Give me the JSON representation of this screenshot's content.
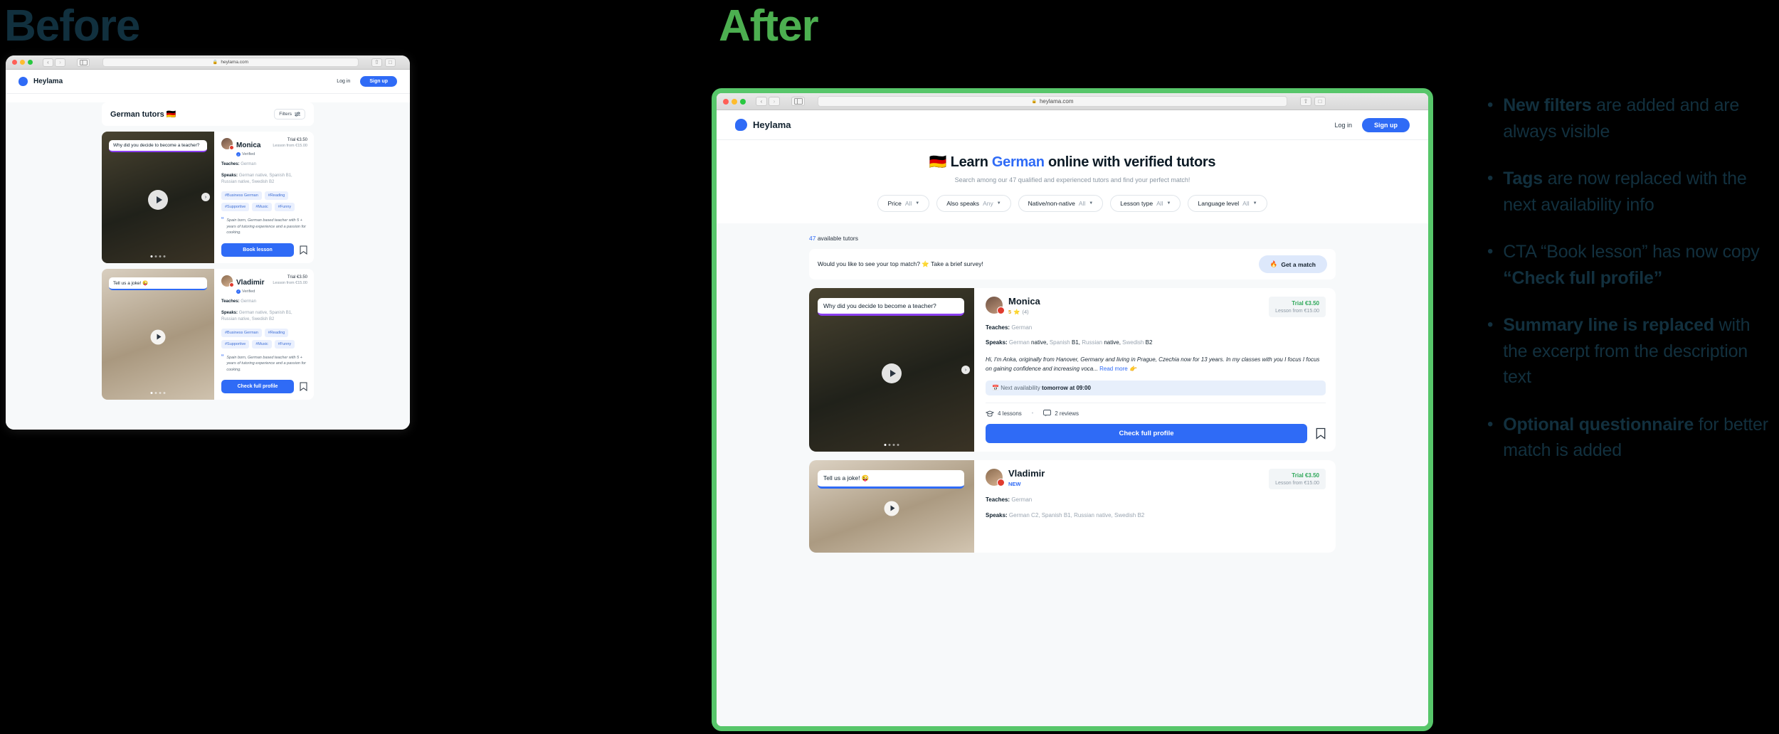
{
  "section_titles": {
    "before": "Before",
    "after": "After"
  },
  "colors": {
    "accent_blue": "#2f6bf6",
    "after_green": "#4caf50",
    "heading_navy": "#12303e",
    "chip_purple": "#8b3ff0"
  },
  "browser": {
    "url": "heylama.com",
    "lock_icon": "lock-icon",
    "back_icon": "‹",
    "forward_icon": "›",
    "sidebar_icon": "sidebar-icon",
    "share_icon": "share-icon",
    "tabs_icon": "new-tab-icon",
    "plus_icon": "+"
  },
  "site_header": {
    "brand": "Heylama",
    "login": "Log in",
    "signup": "Sign up"
  },
  "before": {
    "page_title": "German tutors 🇩🇪",
    "filters_label": "Filters",
    "filters_icon": "sliders-icon",
    "cards": [
      {
        "video_question": "Why did you decide to become a teacher?",
        "name": "Monica",
        "verified": "Verified",
        "trial": "Trial €3.50",
        "lesson_from": "Lesson from €15.00",
        "teaches_label": "Teaches:",
        "teaches_value": "German",
        "speaks_label": "Speaks:",
        "speaks_value": "German native, Spanish B1, Russian native, Swedish B2",
        "tags": [
          "#Business German",
          "#Reading",
          "#Supportive",
          "#Music",
          "#Funny"
        ],
        "quote": "Spain born, German based teacher with 5 + years of tutoring experience and a passion for cooking.",
        "cta": "Book lesson",
        "bookmark_icon": "bookmark-icon"
      },
      {
        "video_question": "Tell us a joke! 😜",
        "name": "Vladimir",
        "verified": "Verified",
        "trial": "Trial €3.50",
        "lesson_from": "Lesson from €15.00",
        "teaches_label": "Teaches:",
        "teaches_value": "German",
        "speaks_label": "Speaks:",
        "speaks_value": "German native, Spanish B1, Russian native, Swedish B2",
        "tags": [
          "#Business German",
          "#Reading",
          "#Supportive",
          "#Music",
          "#Funny"
        ],
        "quote": "Spain born, German based teacher with 5 + years of tutoring experience and a passion for cooking.",
        "cta": "Check full profile",
        "bookmark_icon": "bookmark-icon"
      }
    ]
  },
  "after": {
    "hero": {
      "flag": "🇩🇪",
      "title_pre": "Learn ",
      "title_highlight": "German",
      "title_post": " online with verified tutors",
      "subtitle": "Search among our 47 qualified and experienced tutors and find your perfect match!"
    },
    "filters": [
      {
        "label": "Price",
        "value": "All"
      },
      {
        "label": "Also speaks",
        "value": "Any"
      },
      {
        "label": "Native/non-native",
        "value": "All"
      },
      {
        "label": "Lesson type",
        "value": "All"
      },
      {
        "label": "Language level",
        "value": "All"
      }
    ],
    "count_number": "47",
    "count_text": " available tutors",
    "survey": {
      "text": "Would you like to see your top match? ⭐ Take a brief survey!",
      "button": "Get a match",
      "button_icon": "🔥"
    },
    "cards": [
      {
        "video_question": "Why did you decide to become a teacher?",
        "name": "Monica",
        "rating": "5",
        "star_icon": "⭐",
        "review_count": "(4)",
        "trial": "Trial €3.50",
        "lesson_from": "Lesson from €15.00",
        "teaches_label": "Teaches:",
        "teaches_value": "German",
        "speaks_label": "Speaks:",
        "speaks_parts": [
          "German",
          " native, ",
          "Spanish",
          " B1, ",
          "Russian",
          " native, ",
          "Swedish",
          " B2"
        ],
        "description": "Hi, I'm Anka, originally from Hanover, Germany and living in Prague, Czechia now for 13 years. In my classes with you I focus I focus on gaining confidence and increasing voca...",
        "read_more": "Read more",
        "read_more_icon": "👉",
        "availability_icon": "📅",
        "availability_label": "Next availability ",
        "availability_value": "tomorrow at 09:00",
        "lessons": "4 lessons",
        "lessons_icon": "graduation-cap-icon",
        "reviews": "2 reviews",
        "reviews_icon": "comment-icon",
        "cta": "Check full profile",
        "bookmark_icon": "bookmark-icon"
      },
      {
        "video_question": "Tell us a joke! 😜",
        "name": "Vladimir",
        "badge": "NEW",
        "trial": "Trial €3.50",
        "lesson_from": "Lesson from €15.00",
        "teaches_label": "Teaches:",
        "teaches_value": "German",
        "speaks_label": "Speaks:",
        "speaks_value": "German C2, Spanish B1, Russian native, Swedish B2"
      }
    ]
  },
  "notes": [
    {
      "bold": "New filters",
      "rest": " are added and are always visible"
    },
    {
      "bold": "Tags",
      "rest": " are now replaced with the next availability info"
    },
    {
      "pre": "CTA “Book lesson” has now copy ",
      "bold": "“Check full profile”",
      "rest": ""
    },
    {
      "bold": "Summary line is replaced",
      "rest": " with the excerpt from the description text"
    },
    {
      "bold": "Optional questionnaire",
      "rest": " for better match is added"
    }
  ]
}
